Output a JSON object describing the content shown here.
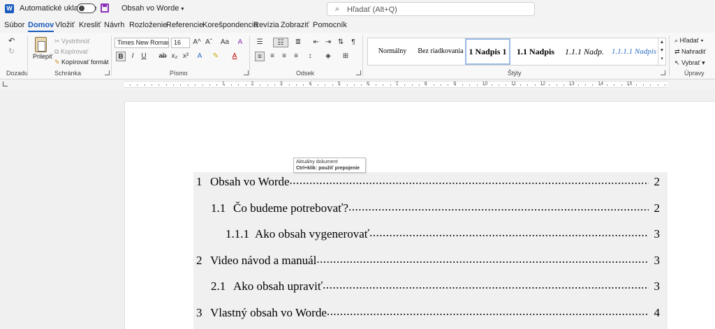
{
  "titlebar": {
    "autosave_label": "Automatické ukladanie",
    "doc_title": "Obsah vo Worde",
    "search_placeholder": "Hľadať (Alt+Q)"
  },
  "menu": {
    "tabs": [
      "Súbor",
      "Domov",
      "Vložiť",
      "Kresliť",
      "Návrh",
      "Rozloženie",
      "Referencie",
      "Korešpondencia",
      "Revízia",
      "Zobraziť",
      "Pomocník"
    ],
    "active": "Domov"
  },
  "ribbon": {
    "undo": {
      "group_label": "Dozadu"
    },
    "clipboard": {
      "group_label": "Schránka",
      "paste": "Prilepiť",
      "cut": "Vystrihnúť",
      "copy": "Kopírovať",
      "format_painter": "Kopírovať formát"
    },
    "font": {
      "group_label": "Písmo",
      "font_name": "Times New Roman (",
      "font_size": "16",
      "bold": "B",
      "italic": "I",
      "underline": "U",
      "strike": "ab",
      "subscript": "x₂",
      "superscript": "x²",
      "grow": "A^",
      "shrink": "Aˇ",
      "case": "Aa",
      "clear": "A"
    },
    "paragraph": {
      "group_label": "Odsek"
    },
    "styles": {
      "group_label": "Štýly",
      "items": [
        "Normálny",
        "Bez riadkovania",
        "1  Nadpis 1",
        "1.1  Nadpis",
        "1.1.1  Nadp.",
        "1.1.1.1  Nadpis"
      ]
    },
    "editing": {
      "group_label": "Úpravy",
      "find": "Hľadať",
      "replace": "Nahradiť",
      "select": "Vybrať"
    }
  },
  "ruler": {
    "numbers": [
      "1",
      "2",
      "3",
      "4",
      "5",
      "6",
      "7",
      "8",
      "9",
      "10",
      "11",
      "12",
      "13",
      "14",
      "15"
    ]
  },
  "tooltip": {
    "line1": "Aktuálny dokument",
    "line2": "Ctrl+klik: použiť prepojenie"
  },
  "toc": [
    {
      "num": "1",
      "title": "Obsah vo Worde",
      "page": "2",
      "level": 1
    },
    {
      "num": "1.1",
      "title": "Čo budeme potrebovať?",
      "page": "2",
      "level": 2
    },
    {
      "num": "1.1.1",
      "title": "Ako obsah vygenerovať",
      "page": "3",
      "level": 3
    },
    {
      "num": "2",
      "title": "Video návod a manuál",
      "page": "3",
      "level": 1
    },
    {
      "num": "2.1",
      "title": "Ako obsah upraviť",
      "page": "3",
      "level": 2
    },
    {
      "num": "3",
      "title": "Vlastný obsah vo Worde",
      "page": "4",
      "level": 1
    }
  ]
}
